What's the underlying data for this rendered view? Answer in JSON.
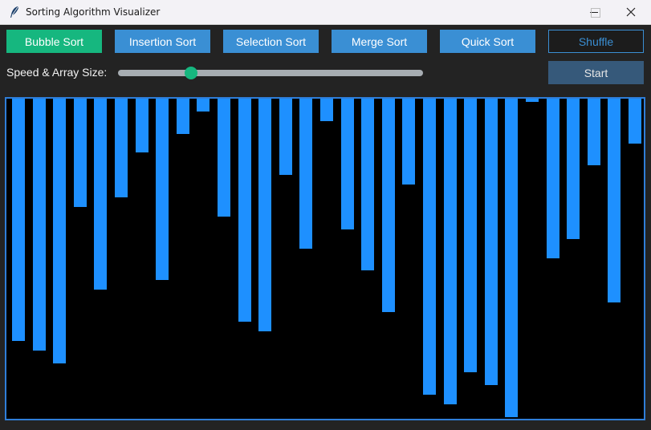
{
  "window": {
    "title": "Sorting Algorithm Visualizer",
    "icons": [
      "feather-icon",
      "minimize-icon",
      "maximize-icon",
      "close-icon"
    ]
  },
  "toolbar": {
    "bubble_label": "Bubble Sort",
    "insertion_label": "Insertion Sort",
    "selection_label": "Selection Sort",
    "merge_label": "Merge Sort",
    "quick_label": "Quick Sort",
    "shuffle_label": "Shuffle",
    "start_label": "Start"
  },
  "controls": {
    "speed_label": "Speed & Array Size:",
    "slider_fraction": 0.24
  },
  "colors": {
    "bar": "#1e90ff",
    "accent_green": "#16b77f",
    "button_blue": "#3a8fd4",
    "start_blue": "#36597a"
  },
  "array": {
    "values": [
      0.76,
      0.79,
      0.83,
      0.34,
      0.6,
      0.31,
      0.17,
      0.57,
      0.11,
      0.04,
      0.37,
      0.7,
      0.73,
      0.24,
      0.47,
      0.07,
      0.41,
      0.54,
      0.67,
      0.27,
      0.93,
      0.96,
      0.86,
      0.9,
      1.0,
      0.01,
      0.5,
      0.44,
      0.21,
      0.64,
      0.14
    ]
  }
}
